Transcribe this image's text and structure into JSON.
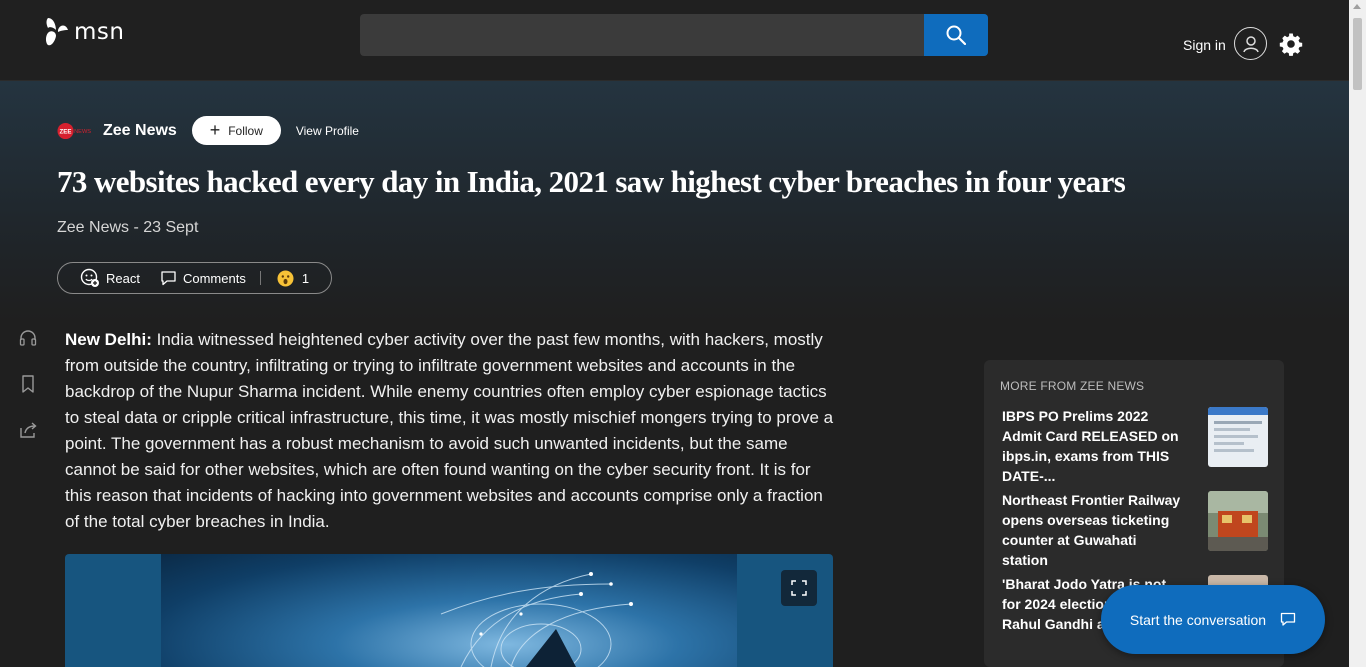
{
  "header": {
    "logo_text": "msn",
    "search_placeholder": "",
    "signin_label": "Sign in"
  },
  "source": {
    "logo_text": "ZEE NEWS",
    "name": "Zee News",
    "follow_label": "Follow",
    "view_profile_label": "View Profile"
  },
  "article": {
    "headline": "73 websites hacked every day in India, 2021 saw highest cyber breaches in four years",
    "byline": "Zee News - 23 Sept",
    "dateline": "New Delhi:",
    "body": " India witnessed heightened cyber activity over the past few months, with hackers, mostly from outside the country, infiltrating or trying to infiltrate government websites and accounts in the backdrop of the Nupur Sharma incident. While enemy countries often employ cyber espionage tactics to steal data or cripple critical infrastructure, this time, it was mostly mischief mongers trying to prove a point. The government has a robust mechanism to avoid such unwanted incidents, but the same cannot be said for other websites, which are often found wanting on the cyber security front. It is for this reason that incidents of hacking into government websites and accounts comprise only a fraction of the total cyber breaches in India."
  },
  "reactions": {
    "react_label": "React",
    "comments_label": "Comments",
    "reaction_count": "1"
  },
  "more_from": {
    "title": "MORE FROM ZEE NEWS",
    "items": [
      {
        "title": "IBPS PO Prelims 2022 Admit Card RELEASED on ibps.in, exams from THIS DATE-..."
      },
      {
        "title": "Northeast Frontier Railway opens overseas ticketing counter at Guwahati station"
      },
      {
        "title": "'Bharat Jodo Yatra is not for 2024 elections but' Rahul Gandhi asserts"
      }
    ]
  },
  "chat": {
    "label": "Start the conversation"
  },
  "colors": {
    "accent": "#0f6cbd",
    "brand_red": "#d6202e"
  }
}
